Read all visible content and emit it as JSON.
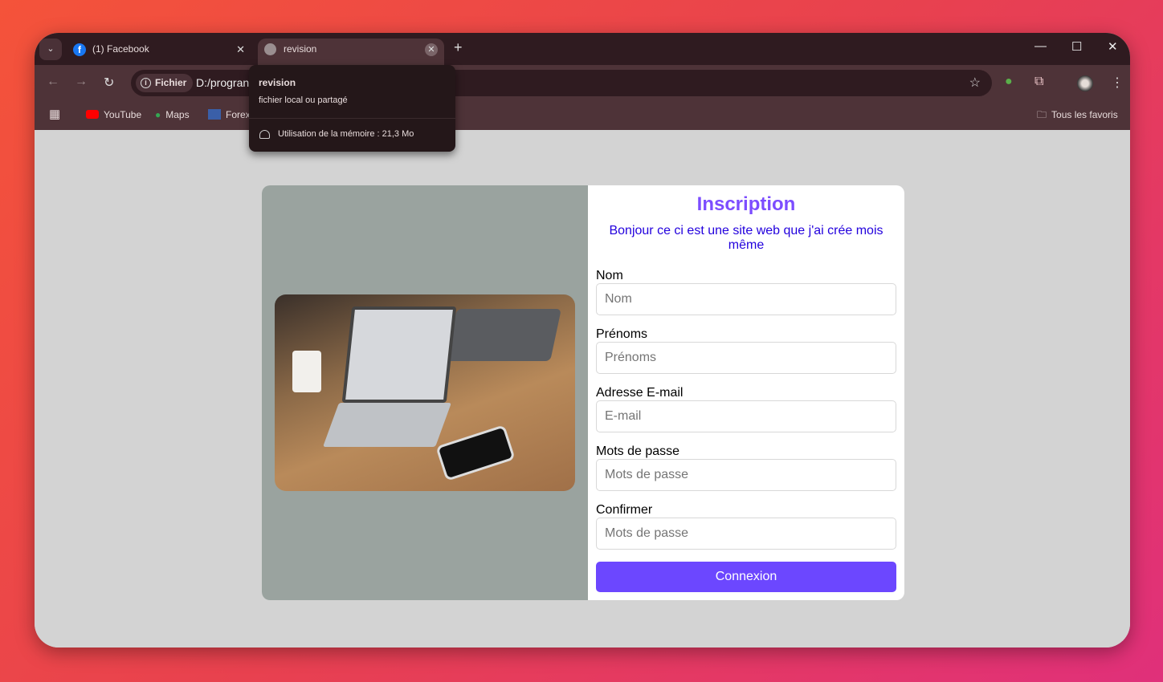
{
  "browser": {
    "tabs": [
      {
        "title": "(1) Facebook",
        "icon": "facebook-icon"
      },
      {
        "title": "revision",
        "icon": "globe-icon",
        "active": true
      }
    ],
    "tooltip": {
      "title": "revision",
      "subtitle": "fichier local ou partagé",
      "memory": "Utilisation de la mémoire : 21,3 Mo"
    },
    "address": {
      "chip": "Fichier",
      "url": "D:/progran"
    },
    "bookmarks": [
      {
        "label": "YouTube"
      },
      {
        "label": "Maps"
      },
      {
        "label": "Forex"
      }
    ],
    "all_bookmarks": "Tous les favoris"
  },
  "page": {
    "title": "Inscription",
    "subtitle": "Bonjour ce ci est une site web que j'ai crée mois même",
    "accent": "#7c4dff",
    "fields": [
      {
        "label": "Nom",
        "placeholder": "Nom"
      },
      {
        "label": "Prénoms",
        "placeholder": "Prénoms"
      },
      {
        "label": "Adresse E-mail",
        "placeholder": "E-mail"
      },
      {
        "label": "Mots de passe",
        "placeholder": "Mots de passe"
      },
      {
        "label": "Confirmer",
        "placeholder": "Mots de passe"
      }
    ],
    "submit": "Connexion"
  }
}
